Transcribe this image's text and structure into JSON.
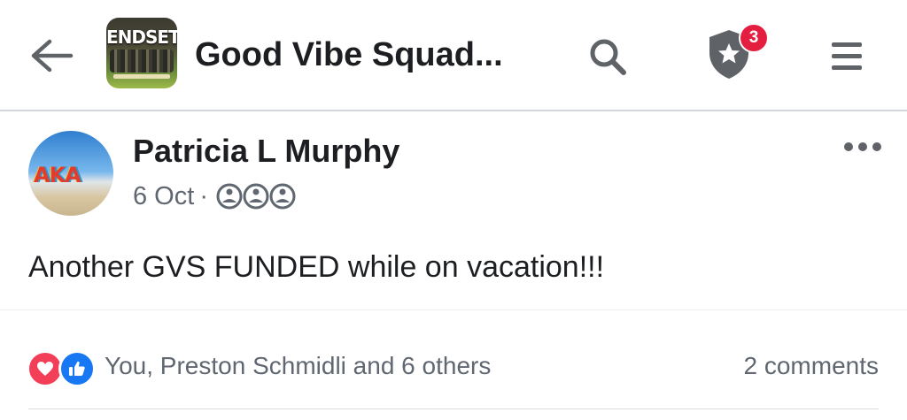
{
  "header": {
    "group_name": "Good Vibe Squad...",
    "group_thumb_text": "ENDSET",
    "notification_count": "3",
    "icons": {
      "back": "arrow-left-icon",
      "search": "search-icon",
      "shield": "shield-star-icon",
      "menu": "hamburger-menu-icon"
    }
  },
  "post": {
    "author": "Patricia L Murphy",
    "date": "6 Oct",
    "separator": "·",
    "privacy_icon": "group-members-icon",
    "avatar_letters": "AKA",
    "more_icon": "more-dots-icon",
    "text": "Another GVS FUNDED while on vacation!!!",
    "reactions": {
      "icons": [
        "love-reaction-icon",
        "like-reaction-icon"
      ],
      "summary": "You, Preston Schmidli and 6 others"
    },
    "comments": "2 comments"
  },
  "colors": {
    "text_primary": "#1c1e21",
    "text_secondary": "#606770",
    "icon_gray": "#5f6368",
    "badge_red": "#e41e3f",
    "like_blue": "#1877f2",
    "love_red": "#f33e58"
  }
}
